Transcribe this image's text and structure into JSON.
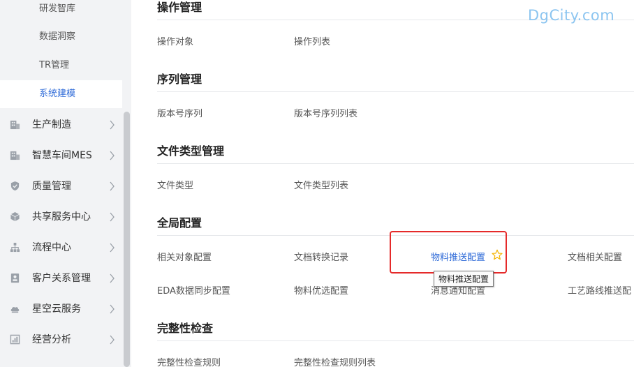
{
  "sidebar": {
    "sub_items": [
      {
        "label": "研发智库"
      },
      {
        "label": "数据洞察"
      },
      {
        "label": "TR管理"
      },
      {
        "label": "系统建模"
      }
    ],
    "menu_items": [
      {
        "label": "生产制造",
        "icon": "building-icon"
      },
      {
        "label": "智慧车间MES",
        "icon": "building-icon"
      },
      {
        "label": "质量管理",
        "icon": "shield-icon"
      },
      {
        "label": "共享服务中心",
        "icon": "hexagon-icon"
      },
      {
        "label": "流程中心",
        "icon": "hierarchy-icon"
      },
      {
        "label": "客户关系管理",
        "icon": "contact-card-icon"
      },
      {
        "label": "星空云服务",
        "icon": "cloud-icon"
      },
      {
        "label": "经营分析",
        "icon": "analytics-icon"
      }
    ]
  },
  "main": {
    "sections": [
      {
        "title": "操作管理",
        "links": [
          "操作对象",
          "操作列表"
        ]
      },
      {
        "title": "序列管理",
        "links": [
          "版本号序列",
          "版本号序列列表"
        ]
      },
      {
        "title": "文件类型管理",
        "links": [
          "文件类型",
          "文件类型列表"
        ]
      },
      {
        "title": "全局配置",
        "rows": [
          [
            "相关对象配置",
            "文档转换记录",
            "物料推送配置",
            "文档相关配置"
          ],
          [
            "EDA数据同步配置",
            "物料优选配置",
            "消息通知配置",
            "工艺路线推送配"
          ]
        ]
      },
      {
        "title": "完整性检查",
        "links": [
          "完整性检查规则",
          "完整性检查规则列表"
        ]
      }
    ],
    "tooltip": "物料推送配置"
  },
  "watermark": "DgCity.com",
  "colors": {
    "accent": "#2f6bd8",
    "highlight_box": "#e52a2a",
    "star": "#f5b400"
  }
}
